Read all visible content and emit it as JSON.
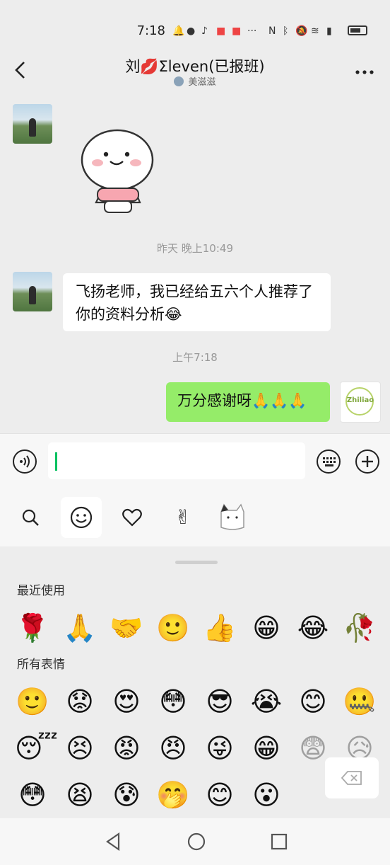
{
  "status_bar": {
    "time": "7:18",
    "icons": [
      "notification-bell-icon",
      "network-icon",
      "music-icon",
      "app-icon",
      "app-icon",
      "more-icon",
      "nfc-icon",
      "bluetooth-icon",
      "mute-icon",
      "wifi-icon",
      "signal-icon",
      "battery-icon"
    ]
  },
  "header": {
    "title": "刘💋Σleven(已报班)",
    "subtitle": "美滋滋"
  },
  "messages": [
    {
      "type": "sticker",
      "sender": "other"
    },
    {
      "type": "timestamp",
      "text": "昨天 晚上10:49"
    },
    {
      "type": "text",
      "sender": "other",
      "text": "飞扬老师，我已经给五六个人推荐了你的资料分析😂"
    },
    {
      "type": "timestamp",
      "text": "上午7:18"
    },
    {
      "type": "text",
      "sender": "me",
      "text": "万分感谢呀🙏🙏🙏"
    }
  ],
  "my_avatar_text": "Zhiliao",
  "input": {
    "value": ""
  },
  "emoji_panel": {
    "recent_title": "最近使用",
    "all_title": "所有表情",
    "recent": [
      "🌹",
      "🙏",
      "🤝",
      "🙂",
      "👍",
      "😁",
      "😂",
      "🥀"
    ],
    "all": [
      "🙂",
      "😟",
      "😍",
      "😳",
      "😎",
      "😭",
      "😊",
      "🤐",
      "😴",
      "😣",
      "😡",
      "😠",
      "😜",
      "😁",
      "😨",
      "😥",
      "😳",
      "😫",
      "😰",
      "🤭",
      "😊",
      "😮"
    ],
    "faded_indices": [
      14,
      15
    ]
  }
}
